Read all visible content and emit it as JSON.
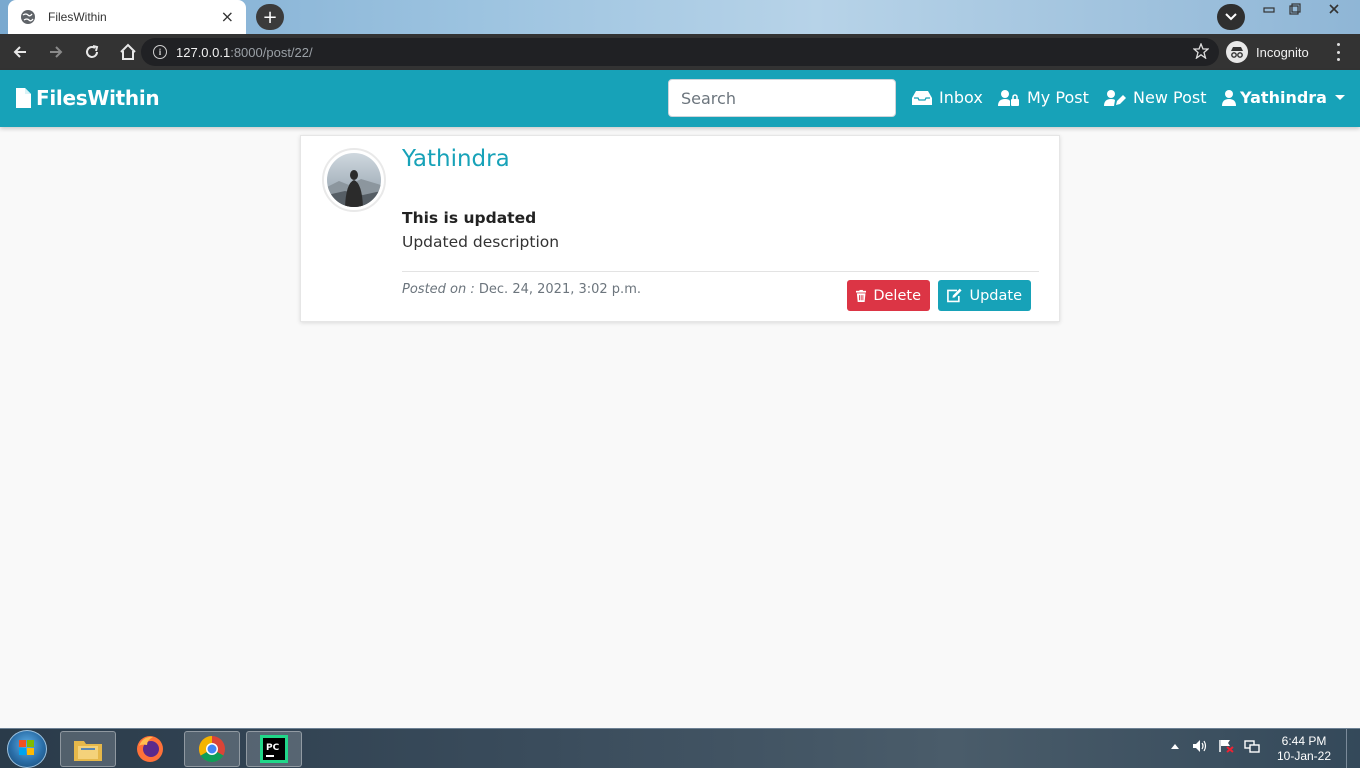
{
  "browser": {
    "tab_title": "FilesWithin",
    "tab_close": "×",
    "new_tab": "+",
    "url_host": "127.0.0.1",
    "url_path": ":8000/post/22/",
    "incognito_label": "Incognito"
  },
  "navbar": {
    "brand": "FilesWithin",
    "search_placeholder": "Search",
    "links": {
      "inbox": "Inbox",
      "my_post": "My Post",
      "new_post": "New Post",
      "user": "Yathindra"
    },
    "color": "#17a2b8"
  },
  "post": {
    "author": "Yathindra",
    "title": "This is updated",
    "description": "Updated description",
    "posted_label": "Posted on :",
    "posted_date": "Dec. 24, 2021, 3:02 p.m.",
    "delete_label": "Delete",
    "update_label": "Update",
    "delete_color": "#dc3545",
    "update_color": "#17a2b8"
  },
  "taskbar": {
    "time": "6:44 PM",
    "date": "10-Jan-22"
  }
}
